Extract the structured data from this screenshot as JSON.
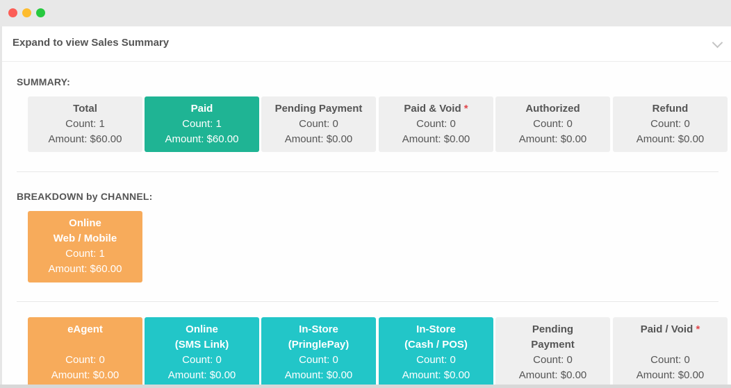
{
  "expander": {
    "title": "Expand to view Sales Summary"
  },
  "summary": {
    "heading": "SUMMARY:",
    "cards": [
      {
        "title": "Total",
        "count": "Count: 1",
        "amount": "Amount: $60.00"
      },
      {
        "title": "Paid",
        "count": "Count: 1",
        "amount": "Amount: $60.00"
      },
      {
        "title": "Pending Payment",
        "count": "Count: 0",
        "amount": "Amount: $0.00"
      },
      {
        "title": "Paid & Void",
        "marker": "*",
        "count": "Count: 0",
        "amount": "Amount: $0.00"
      },
      {
        "title": "Authorized",
        "count": "Count: 0",
        "amount": "Amount: $0.00"
      },
      {
        "title": "Refund",
        "count": "Count: 0",
        "amount": "Amount: $0.00"
      }
    ]
  },
  "breakdown": {
    "heading": "BREAKDOWN by CHANNEL:",
    "online": {
      "title1": "Online",
      "title2": "Web / Mobile",
      "count": "Count: 1",
      "amount": "Amount: $60.00"
    },
    "cards": [
      {
        "title1": "eAgent",
        "title2": "",
        "count": "Count: 0",
        "amount": "Amount: $0.00"
      },
      {
        "title1": "Online",
        "title2": "(SMS Link)",
        "count": "Count: 0",
        "amount": "Amount: $0.00"
      },
      {
        "title1": "In-Store",
        "title2": "(PringlePay)",
        "count": "Count: 0",
        "amount": "Amount: $0.00"
      },
      {
        "title1": "In-Store",
        "title2": "(Cash / POS)",
        "count": "Count: 0",
        "amount": "Amount: $0.00"
      },
      {
        "title1": "Pending",
        "title2": "Payment",
        "count": "Count: 0",
        "amount": "Amount: $0.00"
      },
      {
        "title1": "Paid / Void",
        "marker": "*",
        "title2": "",
        "count": "Count: 0",
        "amount": "Amount: $0.00"
      }
    ]
  },
  "colors": {
    "paid": "#1fb494",
    "orange": "#f7ab5b",
    "teal": "#22c6c8",
    "neutral": "#efefef",
    "required": "#e0474c"
  }
}
